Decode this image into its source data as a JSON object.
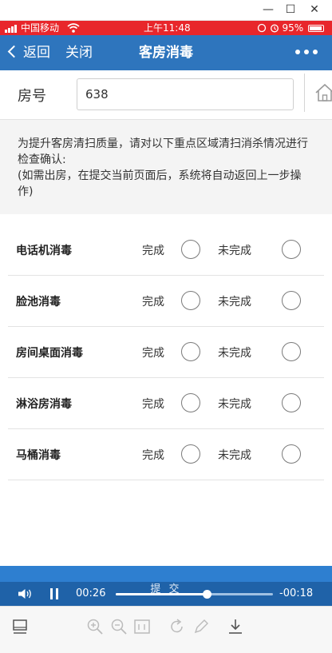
{
  "window": {
    "minimize_glyph": "—",
    "maximize_glyph": "☐",
    "close_glyph": "✕"
  },
  "status_bar": {
    "carrier": "中国移动",
    "time": "上午11:48",
    "battery": "95%",
    "color": "#e8262b"
  },
  "nav": {
    "back_label": "返回",
    "close_label": "关闭",
    "title": "客房消毒",
    "more_icon": "more-dots-icon",
    "color": "#2e75bd"
  },
  "room": {
    "label": "房号",
    "value": "638"
  },
  "notice": {
    "line1": "为提升客房清扫质量，请对以下重点区域清扫消杀情况进行检查确认:",
    "line2": "(如需出房，在提交当前页面后，系统将自动返回上一步操作)"
  },
  "checklist": {
    "done_label": "完成",
    "not_done_label": "未完成",
    "items": [
      {
        "label": "电话机消毒"
      },
      {
        "label": "脸池消毒"
      },
      {
        "label": "房间桌面消毒"
      },
      {
        "label": "淋浴房消毒"
      },
      {
        "label": "马桶消毒"
      }
    ]
  },
  "submit": {
    "label": "提 交"
  },
  "player": {
    "current_time": "00:26",
    "remaining_time": "-00:18",
    "progress": 0.58
  },
  "toolbar": {
    "icons": [
      "display-icon",
      "zoom-in-icon",
      "zoom-out-icon",
      "actual-size-icon",
      "rotate-icon",
      "edit-icon",
      "download-icon"
    ]
  }
}
